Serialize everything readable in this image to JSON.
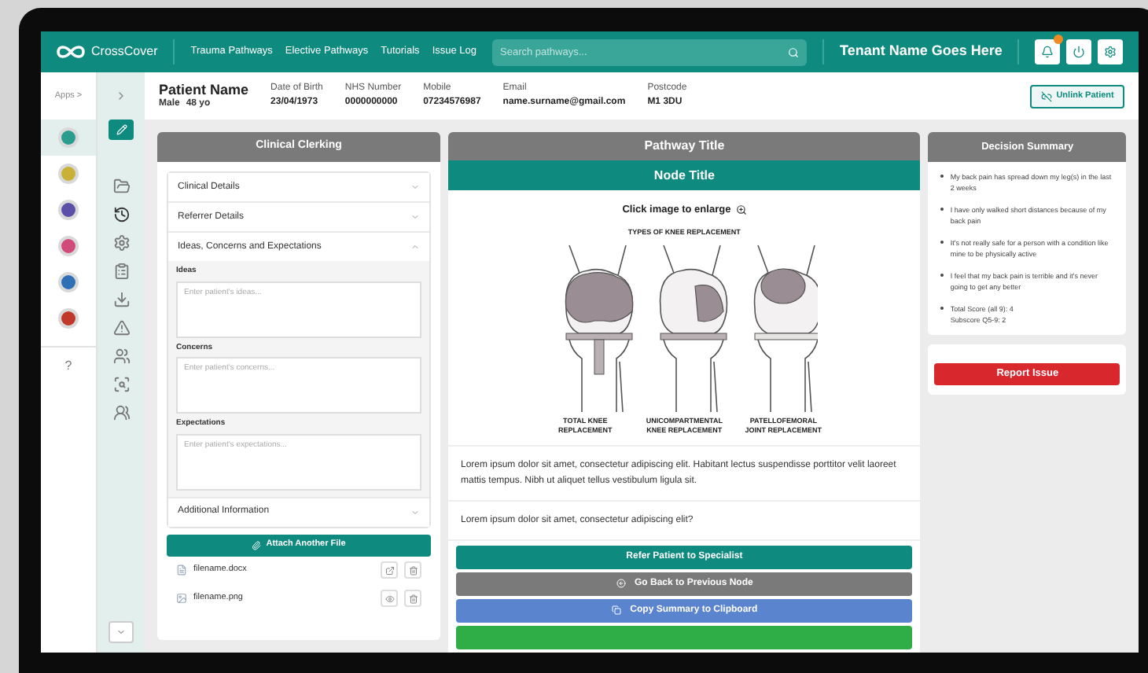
{
  "header": {
    "app_name": "CrossCover",
    "nav": [
      "Trauma Pathways",
      "Elective Pathways",
      "Tutorials",
      "Issue Log"
    ],
    "search": {
      "placeholder": "Search pathways..."
    },
    "tenant": "Tenant Name Goes Here"
  },
  "app_rail": {
    "label": "Apps >",
    "apps": [
      {
        "color": "#2a9d8f",
        "selected": true
      },
      {
        "color": "#c9b037",
        "selected": false
      },
      {
        "color": "#5b4fa8",
        "selected": false
      },
      {
        "color": "#d04a7a",
        "selected": false
      },
      {
        "color": "#2f6fb5",
        "selected": false
      },
      {
        "color": "#c0392b",
        "selected": false
      }
    ],
    "help": "?"
  },
  "patient": {
    "name": "Patient Name",
    "sex": "Male",
    "age": "48 yo",
    "fields": [
      {
        "label": "Date of Birth",
        "value": "23/04/1973"
      },
      {
        "label": "NHS Number",
        "value": "0000000000"
      },
      {
        "label": "Mobile",
        "value": "07234576987"
      },
      {
        "label": "Email",
        "value": "name.surname@gmail.com"
      },
      {
        "label": "Postcode",
        "value": "M1 3DU"
      }
    ],
    "unlink_button": "Unlink Patient"
  },
  "clinical_clerking": {
    "title": "Clinical Clerking",
    "sections": [
      {
        "title": "Clinical Details",
        "expanded": false
      },
      {
        "title": "Referrer Details",
        "expanded": false
      },
      {
        "title": "Ideas, Concerns and Expectations",
        "expanded": true,
        "fields": [
          {
            "label": "Ideas",
            "placeholder": "Enter patient's ideas..."
          },
          {
            "label": "Concerns",
            "placeholder": "Enter patient's concerns..."
          },
          {
            "label": "Expectations",
            "placeholder": "Enter patient's expectations..."
          }
        ]
      },
      {
        "title": "Additional Information",
        "expanded": false
      }
    ],
    "attach_button": "Attach Another File",
    "files": [
      {
        "name": "filename.docx",
        "kind": "document"
      },
      {
        "name": "filename.png",
        "kind": "image"
      }
    ]
  },
  "pathway": {
    "title": "Pathway Title",
    "node_title": "Node Title",
    "enlarge_hint": "Click image to enlarge",
    "figure": {
      "title": "TYPES OF KNEE REPLACEMENT",
      "labels": [
        "TOTAL KNEE REPLACEMENT",
        "UNICOMPARTMENTAL KNEE REPLACEMENT",
        "PATELLOFEMORAL JOINT REPLACEMENT"
      ]
    },
    "paragraphs": [
      "Lorem ipsum dolor sit amet, consectetur adipiscing elit. Habitant lectus suspendisse porttitor velit laoreet mattis tempus. Nibh ut aliquet tellus vestibulum ligula sit.",
      "Lorem ipsum dolor sit amet, consectetur adipiscing elit?"
    ],
    "actions": [
      {
        "kind": "primary",
        "label": "Refer Patient to Specialist"
      },
      {
        "kind": "back",
        "label": "Go Back to Previous Node"
      },
      {
        "kind": "copy",
        "label": "Copy Summary to Clipboard"
      },
      {
        "kind": "confirm"
      }
    ]
  },
  "decision_summary": {
    "title": "Decision Summary",
    "items": [
      {
        "lines": [
          "My back pain has spread down my leg(s) in the last 2 weeks"
        ]
      },
      {
        "lines": [
          "I have only walked short distances because of my back pain"
        ]
      },
      {
        "lines": [
          "It's not really safe for a person with a condition like mine to be physically active"
        ]
      },
      {
        "lines": [
          "I feel that my back pain is terrible and it's never going to get any better"
        ]
      },
      {
        "lines": [
          "Total Score (all 9): 4",
          "Subscore Q5-9: 2"
        ]
      }
    ]
  },
  "report_button": "Report Issue"
}
